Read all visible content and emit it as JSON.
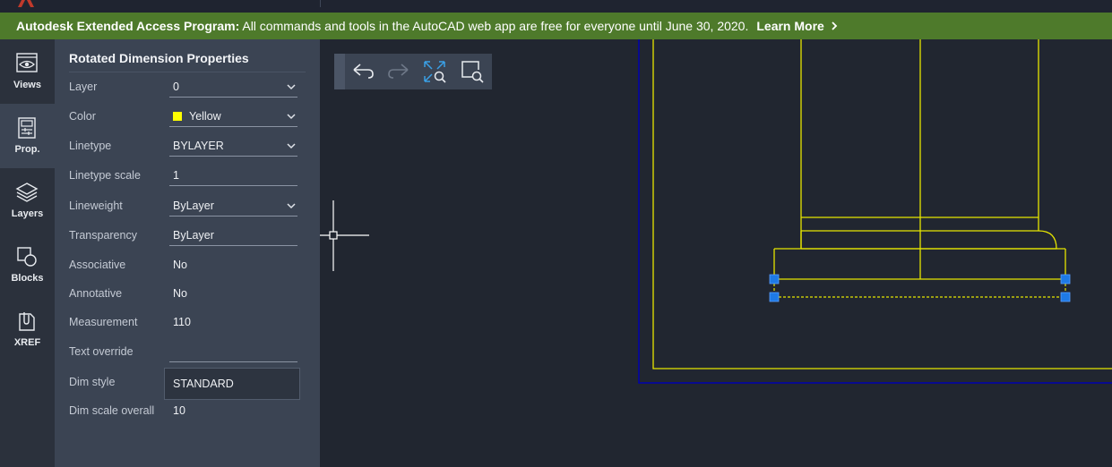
{
  "banner": {
    "bold_text": "Autodesk Extended Access Program:",
    "text": " All commands and tools in the AutoCAD web app are free for everyone until June 30, 2020.",
    "learn_more": "Learn More"
  },
  "rail": [
    {
      "label": "Views",
      "icon": "eye-icon"
    },
    {
      "label": "Prop.",
      "icon": "properties-icon"
    },
    {
      "label": "Layers",
      "icon": "layers-icon"
    },
    {
      "label": "Blocks",
      "icon": "blocks-icon"
    },
    {
      "label": "XREF",
      "icon": "xref-icon"
    }
  ],
  "panel": {
    "title": "Rotated Dimension Properties",
    "props": {
      "layer": {
        "label": "Layer",
        "value": "0"
      },
      "color": {
        "label": "Color",
        "value": "Yellow",
        "swatch": "#ffff00"
      },
      "linetype": {
        "label": "Linetype",
        "value": "BYLAYER"
      },
      "linetype_scale": {
        "label": "Linetype scale",
        "value": "1"
      },
      "lineweight": {
        "label": "Lineweight",
        "value": "ByLayer"
      },
      "transparency": {
        "label": "Transparency",
        "value": "ByLayer"
      },
      "associative": {
        "label": "Associative",
        "value": "No"
      },
      "annotative": {
        "label": "Annotative",
        "value": "No"
      },
      "measurement": {
        "label": "Measurement",
        "value": "110"
      },
      "text_override": {
        "label": "Text override",
        "value": ""
      },
      "dim_style": {
        "label": "Dim style",
        "value": "STANDARD"
      },
      "dim_scale": {
        "label": "Dim scale overall",
        "value": "10"
      }
    }
  },
  "toolbar": {
    "icons": [
      "undo-icon",
      "redo-icon",
      "zoom-extents-icon",
      "zoom-window-icon"
    ]
  },
  "colors": {
    "banner": "#4e7a2b",
    "drawing_lines": "#e6e600",
    "boundary": "#0000b0",
    "grip": "#1e7ae6"
  }
}
